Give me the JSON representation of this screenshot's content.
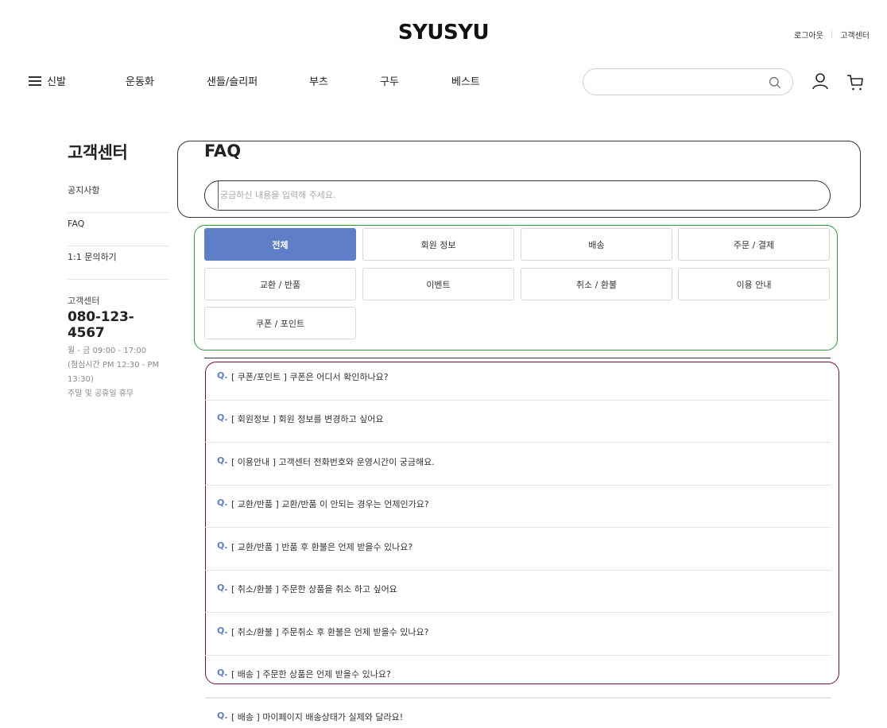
{
  "header": {
    "logo": "SYUSYU",
    "util": {
      "logout": "로그아웃",
      "cs": "고객센터"
    },
    "nav": [
      {
        "label": "신발"
      },
      {
        "label": "운동화"
      },
      {
        "label": "샌들/슬리퍼"
      },
      {
        "label": "부츠"
      },
      {
        "label": "구두"
      },
      {
        "label": "베스트"
      }
    ],
    "search": {
      "placeholder": ""
    }
  },
  "sidebar": {
    "title": "고객센터",
    "menu": [
      {
        "label": "공지사항"
      },
      {
        "label": "FAQ"
      },
      {
        "label": "1:1 문의하기"
      }
    ],
    "cs": {
      "label": "고객센터",
      "phone": "080-123-4567",
      "hours1": "월 - 금 09:00 - 17:00",
      "hours2": "(점심시간 PM 12:30 - PM",
      "hours3": "13:30)",
      "hours4": "주말 및 공휴일 휴무"
    }
  },
  "faq": {
    "title": "FAQ",
    "search_placeholder": "궁금하신 내용을 입력해 주세요.",
    "categories": [
      {
        "label": "전체",
        "active": true
      },
      {
        "label": "회원 정보"
      },
      {
        "label": "배송"
      },
      {
        "label": "주문 / 결제"
      },
      {
        "label": "교환 / 반품"
      },
      {
        "label": "이벤트"
      },
      {
        "label": "취소 / 환불"
      },
      {
        "label": "이용 안내"
      },
      {
        "label": "쿠폰 / 포인트"
      }
    ],
    "q_mark": "Q.",
    "items": [
      {
        "text": "[ 쿠폰/포인트 ] 쿠폰은 어디서 확인하나요?"
      },
      {
        "text": "[ 회원정보 ] 회원 정보를 변경하고 싶어요"
      },
      {
        "text": "[ 이용안내 ] 고객센터 전화번호와 운영시간이 궁금해요."
      },
      {
        "text": "[ 교환/반품 ] 교환/반품 이 안되는 경우는 언제인가요?"
      },
      {
        "text": "[ 교환/반품 ] 반품 후 환불은 언제 받을수 있나요?"
      },
      {
        "text": "[ 취소/환불 ] 주문한 상품을 취소 하고 싶어요"
      },
      {
        "text": "[ 취소/환불 ] 주문취소 후 환불은 언제 받을수 있나요?"
      },
      {
        "text": "[ 배송 ] 주문한 상품은 언제 받을수 있나요?"
      },
      {
        "text": "[ 배송 ] 마이페이지 배송상태가 실제와 달라요!"
      }
    ]
  },
  "colors": {
    "accent": "#5e7fc7",
    "category_outline": "#2e9a3a",
    "list_outline": "#7a1030"
  }
}
